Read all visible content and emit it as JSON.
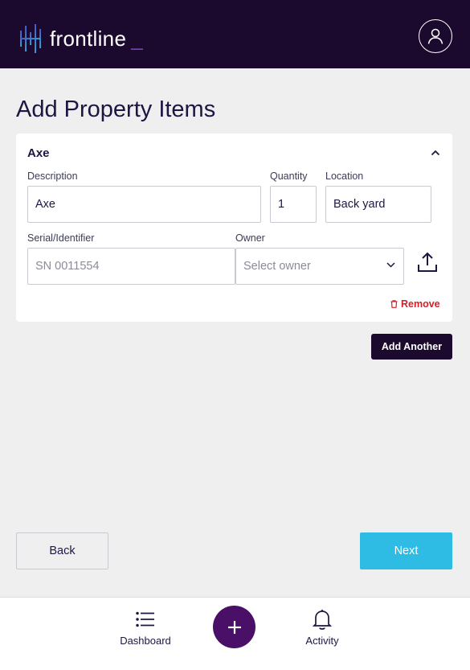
{
  "header": {
    "logo_text": "frontline",
    "logo_cursor": "_",
    "avatar_icon": "user-icon"
  },
  "page": {
    "title": "Add Property Items"
  },
  "item_card": {
    "title": "Axe",
    "fields": {
      "description": {
        "label": "Description",
        "value": "Axe"
      },
      "quantity": {
        "label": "Quantity",
        "value": "1"
      },
      "location": {
        "label": "Location",
        "value": "Back yard"
      },
      "serial": {
        "label": "Serial/Identifier",
        "placeholder": "SN 0011554"
      },
      "owner": {
        "label": "Owner",
        "placeholder": "Select owner"
      }
    },
    "remove_label": "Remove"
  },
  "actions": {
    "add_another_label": "Add Another",
    "back_label": "Back",
    "next_label": "Next"
  },
  "bottom_nav": {
    "dashboard_label": "Dashboard",
    "activity_label": "Activity"
  },
  "colors": {
    "header_bg": "#1b0a2e",
    "accent_purple": "#4a0f66",
    "next_button": "#2ebce5",
    "remove_red": "#d0202a"
  }
}
